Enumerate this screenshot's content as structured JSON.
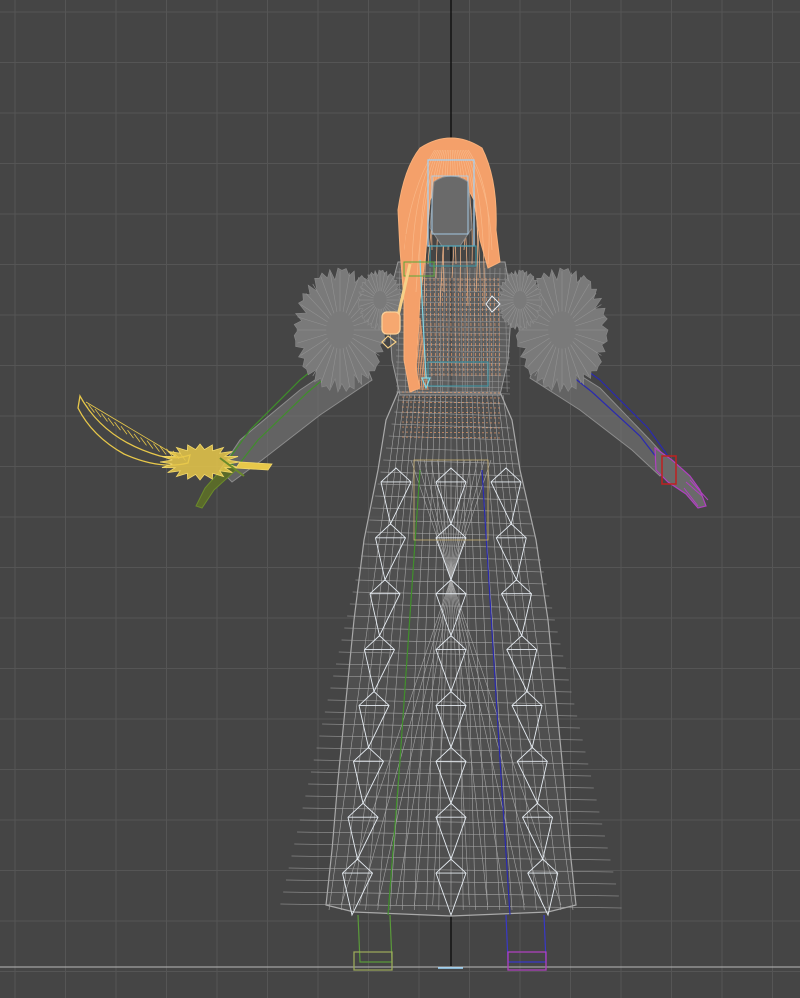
{
  "viewport": {
    "view": "front",
    "mode": "wireframe",
    "grid": true,
    "colors": {
      "background": "#454545",
      "grid_line": "#555555",
      "axis_line": "#000000",
      "floor_line": "#b9b9b9",
      "mesh_gray": "#9a9a9a",
      "fur_gray": "#7a7a7a",
      "hair_orange": "#f4a06a",
      "sword_yellow": "#e8c84a",
      "bone_green": "#3f8f2a",
      "bone_blue": "#2a2ab0",
      "hand_purple": "#b040c0",
      "hand_red": "#c02020",
      "gizmo_cyan": "#7fd6e6",
      "gizmo_white": "#e8eef4"
    },
    "objects": [
      {
        "name": "hair",
        "selected": true
      },
      {
        "name": "sword",
        "selected": false
      },
      {
        "name": "dress",
        "selected": false
      },
      {
        "name": "fur-shoulders",
        "selected": false
      },
      {
        "name": "skeleton-bones",
        "selected": false
      }
    ]
  }
}
